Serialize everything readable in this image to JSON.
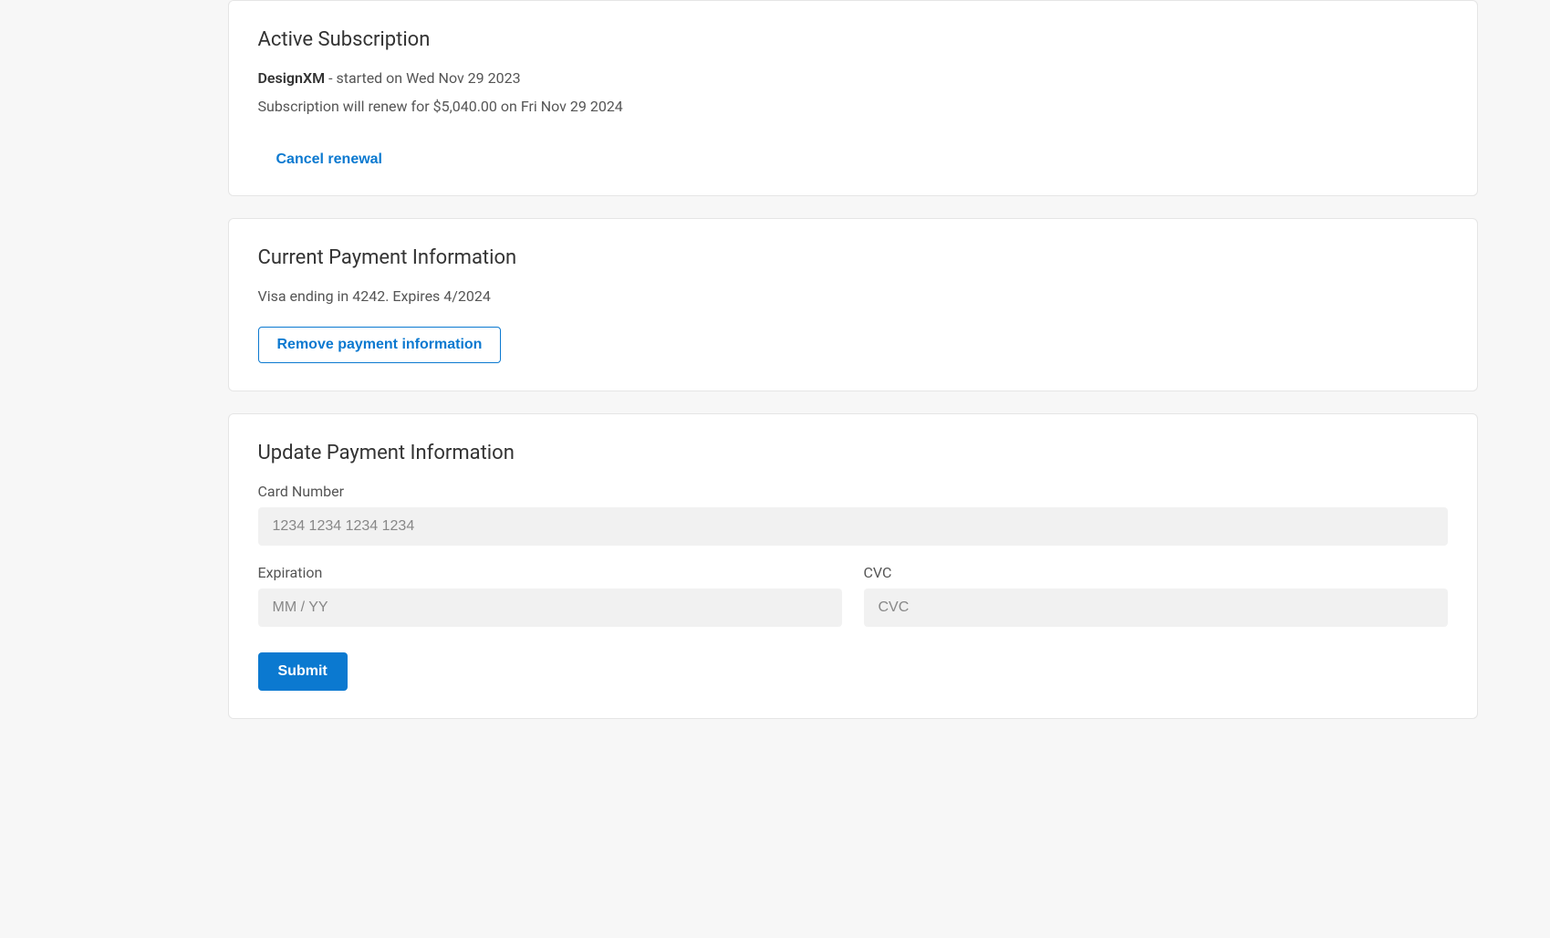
{
  "subscription": {
    "heading": "Active Subscription",
    "plan_name": "DesignXM",
    "started_suffix": " - started on Wed Nov 29 2023",
    "renew_text": "Subscription will renew for $5,040.00 on Fri Nov 29 2024",
    "cancel_label": "Cancel renewal"
  },
  "payment_info": {
    "heading": "Current Payment Information",
    "card_summary": "Visa ending in 4242. Expires 4/2024",
    "remove_label": "Remove payment information"
  },
  "update_payment": {
    "heading": "Update Payment Information",
    "card_number_label": "Card Number",
    "card_number_placeholder": "1234 1234 1234 1234",
    "expiration_label": "Expiration",
    "expiration_placeholder": "MM / YY",
    "cvc_label": "CVC",
    "cvc_placeholder": "CVC",
    "submit_label": "Submit"
  }
}
